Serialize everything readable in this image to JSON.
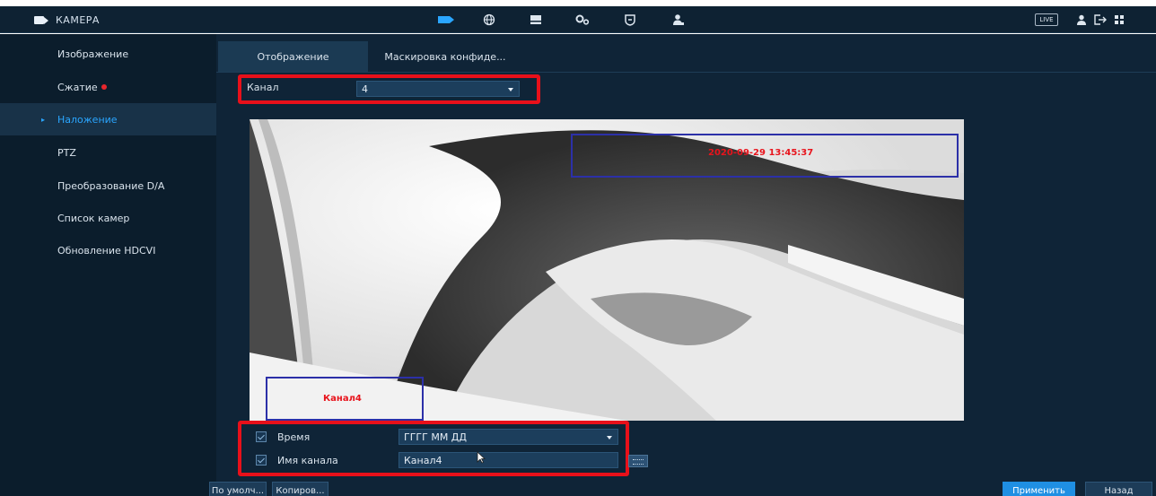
{
  "header": {
    "title": "КАМЕРА",
    "icons": [
      "camera-icon",
      "network-icon",
      "storage-icon",
      "system-icon",
      "security-icon",
      "account-icon"
    ],
    "live_label": "LIVE",
    "accent": "#2aa6ff"
  },
  "sidebar": {
    "items": [
      {
        "label": "Изображение"
      },
      {
        "label": "Сжатие"
      },
      {
        "label": "Наложение"
      },
      {
        "label": "PTZ"
      },
      {
        "label": "Преобразование D/A"
      },
      {
        "label": "Список камер"
      },
      {
        "label": "Обновление HDCVI"
      }
    ],
    "active_index": 2
  },
  "tabs": [
    {
      "label": "Отображение"
    },
    {
      "label": "Маскировка конфиде..."
    }
  ],
  "channel": {
    "label": "Канал",
    "value": "4"
  },
  "preview": {
    "time_overlay": "2020-09-29 13:45:37",
    "channel_overlay": "Канал4"
  },
  "options": {
    "time": {
      "label": "Время",
      "checked": true,
      "format": "ГГГГ ММ ДД"
    },
    "channel_name": {
      "label": "Имя канала",
      "checked": true,
      "value": "Канал4"
    }
  },
  "footer": {
    "default_label": "По умолч...",
    "copy_label": "Копиров...",
    "apply_label": "Применить",
    "back_label": "Назад"
  },
  "colors": {
    "highlight": "#e8101a",
    "overlay_text": "#e8141c",
    "overlay_border": "#2c30a8"
  }
}
